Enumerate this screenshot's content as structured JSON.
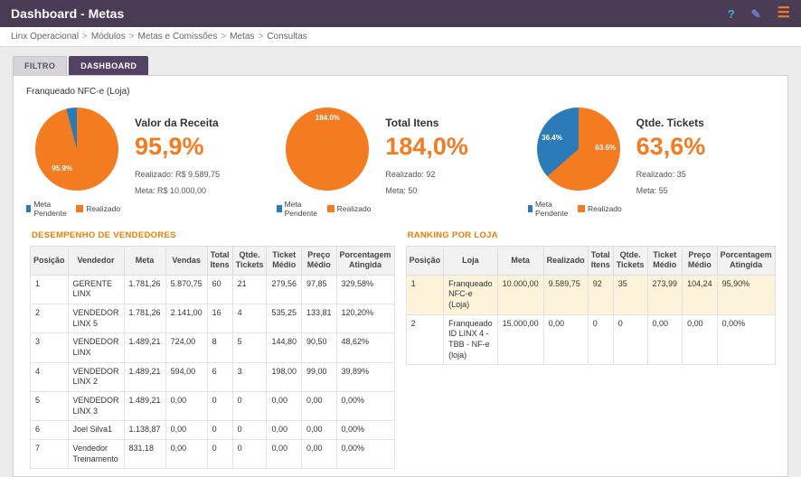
{
  "header": {
    "title": "Dashboard - Metas",
    "icons": {
      "help": "?",
      "edit": "✎",
      "menu": "☰"
    }
  },
  "breadcrumb": {
    "items": [
      "Linx Operacional",
      "Módulos",
      "Metas e Comissões",
      "Metas",
      "Consultas"
    ],
    "separator": ">"
  },
  "tabs": [
    {
      "label": "FILTRO",
      "active": false
    },
    {
      "label": "DASHBOARD",
      "active": true
    }
  ],
  "store_label": "Franqueado NFC-e (Loja)",
  "colors": {
    "meta_pendente": "#2b7bb9",
    "realizado": "#f47b20",
    "accent_orange": "#ef7d00",
    "header_purple": "#493c54",
    "tab_active": "#544164",
    "highlight_row": "#fcf3da"
  },
  "chart_data": [
    {
      "type": "pie",
      "title": "Valor da Receita",
      "big_value": "95,9%",
      "slices": [
        {
          "name": "Realizado",
          "value": 95.9,
          "color": "#f47b20"
        },
        {
          "name": "Meta Pendente",
          "value": 4.1,
          "color": "#2b7bb9"
        }
      ],
      "inner_labels": [
        {
          "text": "95.9%"
        }
      ],
      "realizado_line": "Realizado: R$ 9.589,75",
      "meta_line": "Meta: R$ 10.000,00",
      "legend": [
        "Meta Pendente",
        "Realizado"
      ]
    },
    {
      "type": "pie",
      "title": "Total Itens",
      "big_value": "184,0%",
      "slices": [
        {
          "name": "Realizado",
          "value": 100,
          "color": "#f47b20"
        }
      ],
      "inner_labels": [
        {
          "text": "184.0%"
        }
      ],
      "realizado_line": "Realizado: 92",
      "meta_line": "Meta: 50",
      "legend": [
        "Meta Pendente",
        "Realizado"
      ]
    },
    {
      "type": "pie",
      "title": "Qtde. Tickets",
      "big_value": "63,6%",
      "slices": [
        {
          "name": "Realizado",
          "value": 63.6,
          "color": "#f47b20"
        },
        {
          "name": "Meta Pendente",
          "value": 36.4,
          "color": "#2b7bb9"
        }
      ],
      "inner_labels": [
        {
          "text": "36.4%"
        },
        {
          "text": "63.6%"
        }
      ],
      "realizado_line": "Realizado: 35",
      "meta_line": "Meta: 55",
      "legend": [
        "Meta Pendente",
        "Realizado"
      ]
    }
  ],
  "tables": {
    "vendedores": {
      "title": "DESEMPENHO DE VENDEDORES",
      "headers": [
        "Posição",
        "Vendedor",
        "Meta",
        "Vendas",
        "Total Itens",
        "Qtde. Tickets",
        "Ticket Médio",
        "Preço Médio",
        "Porcentagem Atingida"
      ],
      "rows": [
        [
          "1",
          "GERENTE LINX",
          "1.781,26",
          "5.870,75",
          "60",
          "21",
          "279,56",
          "97,85",
          "329,58%"
        ],
        [
          "2",
          "VENDEDOR LINX 5",
          "1.781,26",
          "2.141,00",
          "16",
          "4",
          "535,25",
          "133,81",
          "120,20%"
        ],
        [
          "3",
          "VENDEDOR LINX",
          "1.489,21",
          "724,00",
          "8",
          "5",
          "144,80",
          "90,50",
          "48,62%"
        ],
        [
          "4",
          "VENDEDOR LINX 2",
          "1.489,21",
          "594,00",
          "6",
          "3",
          "198,00",
          "99,00",
          "39,89%"
        ],
        [
          "5",
          "VENDEDOR LINX 3",
          "1.489,21",
          "0,00",
          "0",
          "0",
          "0,00",
          "0,00",
          "0,00%"
        ],
        [
          "6",
          "Joel Silva1",
          "1.138,87",
          "0,00",
          "0",
          "0",
          "0,00",
          "0,00",
          "0,00%"
        ],
        [
          "7",
          "Vendedor Treinamento",
          "831,18",
          "0,00",
          "0",
          "0",
          "0,00",
          "0,00",
          "0,00%"
        ]
      ],
      "highlight_row": -1
    },
    "ranking": {
      "title": "RANKING POR LOJA",
      "headers": [
        "Posição",
        "Loja",
        "Meta",
        "Realizado",
        "Total Itens",
        "Qtde. Tickets",
        "Ticket Médio",
        "Preço Médio",
        "Porcentagem Atingida"
      ],
      "rows": [
        [
          "1",
          "Franqueado NFC-e (Loja)",
          "10.000,00",
          "9.589,75",
          "92",
          "35",
          "273,99",
          "104,24",
          "95,90%"
        ],
        [
          "2",
          "Franqueado ID LINX 4 - TBB - NF-e (loja)",
          "15.000,00",
          "0,00",
          "0",
          "0",
          "0,00",
          "0,00",
          "0,00%"
        ]
      ],
      "highlight_row": 0
    }
  }
}
